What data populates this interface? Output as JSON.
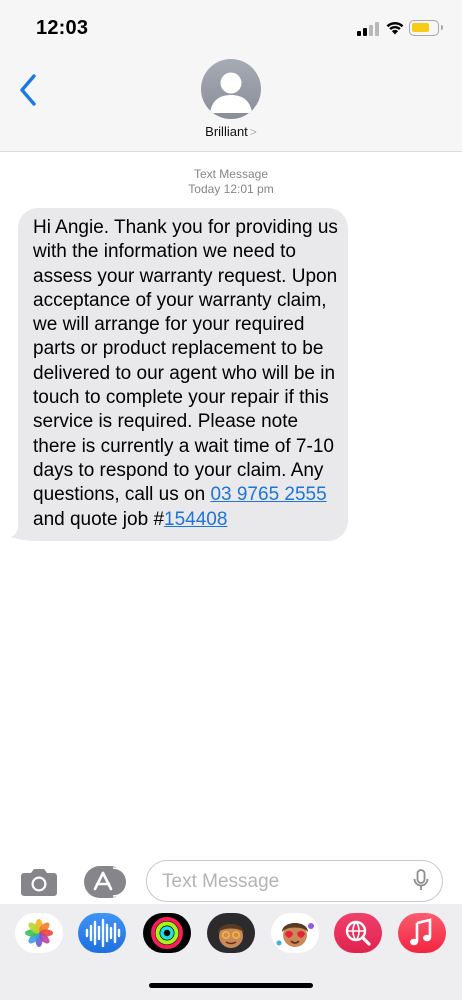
{
  "status_bar": {
    "time": "12:03",
    "signal_icon": "cellular-signal-icon",
    "wifi_icon": "wifi-icon",
    "battery_icon": "battery-low-power-icon",
    "battery_color": "#f7cc17"
  },
  "header": {
    "back_icon": "chevron-left-icon",
    "avatar_icon": "person-silhouette-icon",
    "contact_name": "Brilliant",
    "contact_chevron": ">"
  },
  "conversation": {
    "service_label": "Text Message",
    "timestamp": "Today 12:01 pm",
    "message": {
      "text_part1": "Hi Angie. Thank you for providing us with the information we need to assess your warranty request. Upon acceptance of your warranty claim, we will arrange for your required parts or product replacement to be delivered to our agent who will be in touch to complete your repair if this service is required. Please note there is currently a wait time of 7-10 days to respond to your claim.  Any questions, call us on ",
      "phone_link": "03 9765 2555",
      "text_part2": " and quote job #",
      "job_link": "154408"
    }
  },
  "input_bar": {
    "camera_icon": "camera-icon",
    "apps_icon": "app-store-icon",
    "placeholder": "Text Message",
    "mic_icon": "microphone-icon"
  },
  "app_drawer": {
    "apps": [
      "photos-app-icon",
      "audio-message-app-icon",
      "activity-app-icon",
      "memoji-app-icon",
      "memoji-stickers-app-icon",
      "web-search-app-icon",
      "music-app-icon"
    ]
  },
  "colors": {
    "accent": "#1e74d9",
    "bubble_gray": "#e9e9eb",
    "header_bg": "#f6f6f6"
  }
}
